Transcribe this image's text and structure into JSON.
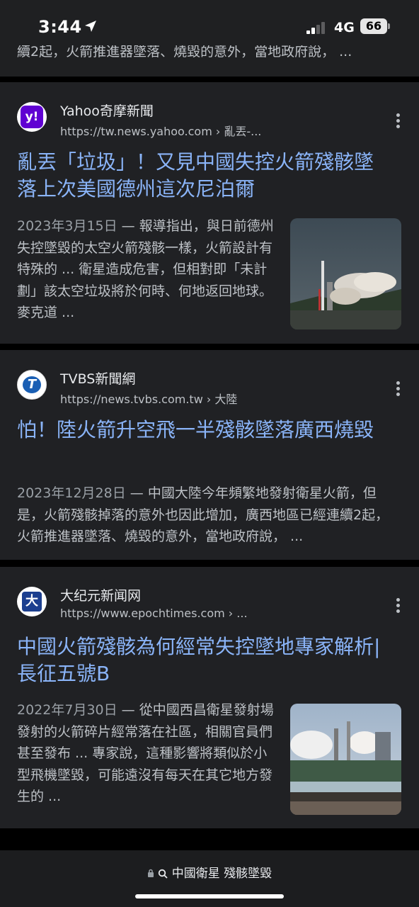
{
  "status_bar": {
    "time": "3:44",
    "network": "4G",
    "battery": "66"
  },
  "top_snippet_fragment": "續2起，火箭推進器墜落、燒毀的意外，當地政府說， ...",
  "results": [
    {
      "site_name": "Yahoo奇摩新聞",
      "url": "https://tw.news.yahoo.com › 亂丟-...",
      "favicon_text": "y!",
      "title": "亂丟「垃圾」！又見中國失控火箭殘骸墜落上次美國德州這次尼泊爾",
      "date": "2023年3月15日",
      "snippet": "報導指出，與日前德州失控墜毀的太空火箭殘骸一樣，火箭設計有特殊的 ... 衛星造成危害，但相對即「未計劃」該太空垃圾將於何時、何地返回地球。麥克道 ..."
    },
    {
      "site_name": "TVBS新聞網",
      "url": "https://news.tvbs.com.tw › 大陸",
      "favicon_text": "T",
      "title": "怕！陸火箭升空飛一半殘骸墜落廣西燒毀",
      "date": "2023年12月28日",
      "snippet": "中國大陸今年頻繁地發射衛星火箭，但是，火箭殘骸掉落的意外也因此增加，廣西地區已經連續2起，火箭推進器墜落、燒毀的意外，當地政府說， ..."
    },
    {
      "site_name": "大纪元新闻网",
      "url": "https://www.epochtimes.com › ...",
      "favicon_text": "大",
      "title": "中國火箭殘骸為何經常失控墜地專家解析| 長征五號B",
      "date": "2022年7月30日",
      "snippet": "從中國西昌衛星發射場發射的火箭碎片經常落在社區，相關官員們甚至發布 ... 專家說，這種影響將類似於小型飛機墜毀，可能遠沒有每天在其它地方發生的 ..."
    }
  ],
  "address_bar": {
    "query": "中國衛星 殘骸墜毀"
  },
  "icons": [
    "location-arrow-icon",
    "signal-icon",
    "lock-icon",
    "search-icon",
    "more-vert-icon"
  ],
  "colors": {
    "title_link": "#8ab4f8",
    "card_bg": "#202124",
    "snippet_text": "#bdc1c6"
  }
}
